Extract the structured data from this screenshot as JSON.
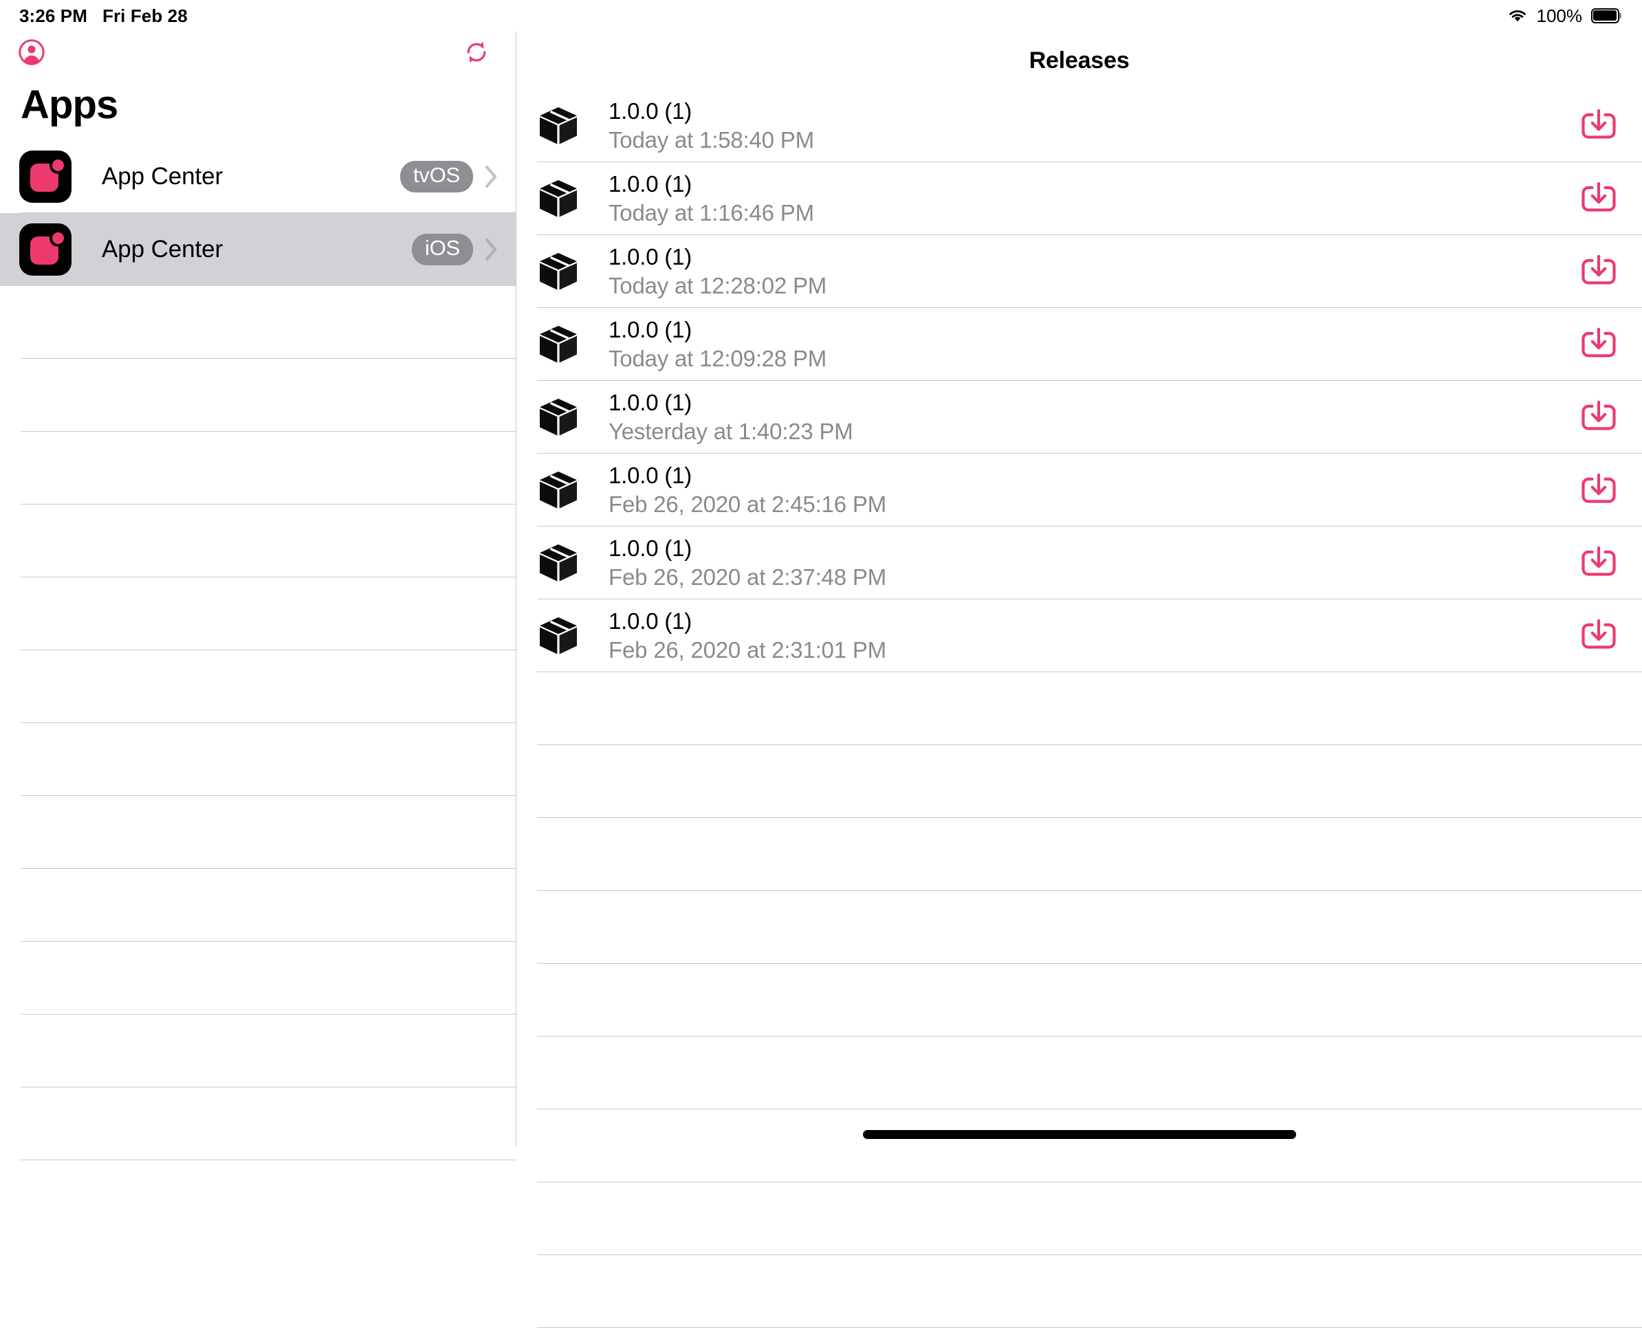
{
  "status_bar": {
    "time": "3:26 PM",
    "date": "Fri Feb 28",
    "battery_percent": "100%",
    "wifi_icon": "wifi-icon",
    "battery_icon": "battery-full-icon"
  },
  "sidebar": {
    "title": "Apps",
    "account_icon": "account-circle-icon",
    "refresh_icon": "refresh-icon",
    "accent_color": "#ec3a6e",
    "selected_index": 1,
    "empty_row_count": 12,
    "apps": [
      {
        "name": "App Center",
        "platform": "tvOS",
        "icon": "app-center-icon",
        "chevron": "chevron-right-icon"
      },
      {
        "name": "App Center",
        "platform": "iOS",
        "icon": "app-center-icon",
        "chevron": "chevron-right-icon"
      }
    ]
  },
  "detail": {
    "title": "Releases",
    "download_icon": "download-icon",
    "package_icon": "package-box-icon",
    "empty_row_count": 9,
    "releases": [
      {
        "version": "1.0.0 (1)",
        "date": "Today at 1:58:40 PM"
      },
      {
        "version": "1.0.0 (1)",
        "date": "Today at 1:16:46 PM"
      },
      {
        "version": "1.0.0 (1)",
        "date": "Today at 12:28:02 PM"
      },
      {
        "version": "1.0.0 (1)",
        "date": "Today at 12:09:28 PM"
      },
      {
        "version": "1.0.0 (1)",
        "date": "Yesterday at 1:40:23 PM"
      },
      {
        "version": "1.0.0 (1)",
        "date": "Feb 26, 2020 at 2:45:16 PM"
      },
      {
        "version": "1.0.0 (1)",
        "date": "Feb 26, 2020 at 2:37:48 PM"
      },
      {
        "version": "1.0.0 (1)",
        "date": "Feb 26, 2020 at 2:31:01 PM"
      }
    ]
  },
  "home_indicator": "home-indicator"
}
